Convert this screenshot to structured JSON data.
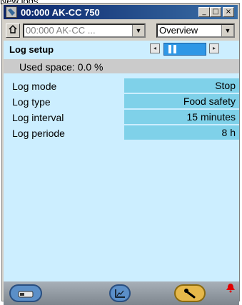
{
  "caption": "New logs",
  "window": {
    "title": "00:000 AK-CC 750",
    "controls": {
      "minimize": "_",
      "maximize": "□",
      "close": "×"
    }
  },
  "toolbar": {
    "device_combo": "00:000 AK-CC ...",
    "view_combo": "Overview"
  },
  "section": {
    "title": "Log setup"
  },
  "used_space": "Used space: 0.0 %",
  "rows": [
    {
      "label": "Log mode",
      "value": "Stop"
    },
    {
      "label": "Log type",
      "value": "Food safety"
    },
    {
      "label": "Log interval",
      "value": "15 minutes"
    },
    {
      "label": "Log periode",
      "value": "8 h"
    }
  ],
  "colors": {
    "panel_bg": "#cceeff",
    "value_cell": "#7fd1e9",
    "used_bar": "#cbcbcb",
    "titlebar": "#0a246a",
    "accent_blue": "#2e97e6"
  },
  "bottom": {
    "icons": [
      "device-icon",
      "graph-icon",
      "wrench-icon",
      "alarm-bell-icon"
    ]
  }
}
